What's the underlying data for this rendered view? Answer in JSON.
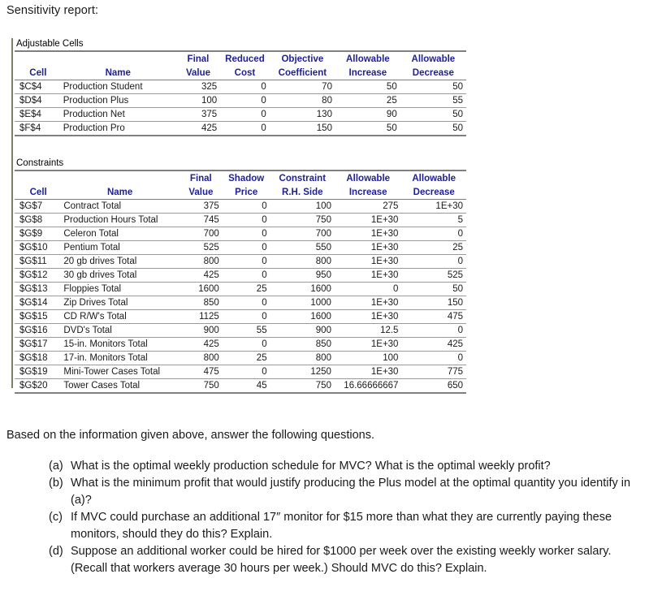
{
  "page": {
    "title": "Sensitivity report:"
  },
  "report": {
    "adjustable": {
      "label": "Adjustable Cells",
      "headers": [
        [
          "",
          "",
          "Final",
          "Reduced",
          "Objective",
          "Allowable",
          "Allowable"
        ],
        [
          "Cell",
          "Name",
          "Value",
          "Cost",
          "Coefficient",
          "Increase",
          "Decrease"
        ]
      ],
      "rows": [
        [
          "$C$4",
          "Production Student",
          "325",
          "0",
          "70",
          "50",
          "50"
        ],
        [
          "$D$4",
          "Production Plus",
          "100",
          "0",
          "80",
          "25",
          "55"
        ],
        [
          "$E$4",
          "Production Net",
          "375",
          "0",
          "130",
          "90",
          "50"
        ],
        [
          "$F$4",
          "Production Pro",
          "425",
          "0",
          "150",
          "50",
          "50"
        ]
      ]
    },
    "constraints": {
      "label": "Constraints",
      "headers": [
        [
          "",
          "",
          "Final",
          "Shadow",
          "Constraint",
          "Allowable",
          "Allowable"
        ],
        [
          "Cell",
          "Name",
          "Value",
          "Price",
          "R.H. Side",
          "Increase",
          "Decrease"
        ]
      ],
      "rows": [
        [
          "$G$7",
          "Contract Total",
          "375",
          "0",
          "100",
          "275",
          "1E+30"
        ],
        [
          "$G$8",
          "Production Hours Total",
          "745",
          "0",
          "750",
          "1E+30",
          "5"
        ],
        [
          "$G$9",
          "Celeron Total",
          "700",
          "0",
          "700",
          "1E+30",
          "0"
        ],
        [
          "$G$10",
          "Pentium Total",
          "525",
          "0",
          "550",
          "1E+30",
          "25"
        ],
        [
          "$G$11",
          "20 gb drives Total",
          "800",
          "0",
          "800",
          "1E+30",
          "0"
        ],
        [
          "$G$12",
          "30 gb drives Total",
          "425",
          "0",
          "950",
          "1E+30",
          "525"
        ],
        [
          "$G$13",
          "Floppies Total",
          "1600",
          "25",
          "1600",
          "0",
          "50"
        ],
        [
          "$G$14",
          "Zip Drives Total",
          "850",
          "0",
          "1000",
          "1E+30",
          "150"
        ],
        [
          "$G$15",
          "CD R/W's Total",
          "1125",
          "0",
          "1600",
          "1E+30",
          "475"
        ],
        [
          "$G$16",
          "DVD's Total",
          "900",
          "55",
          "900",
          "12.5",
          "0"
        ],
        [
          "$G$17",
          "15-in. Monitors Total",
          "425",
          "0",
          "850",
          "1E+30",
          "425"
        ],
        [
          "$G$18",
          "17-in. Monitors Total",
          "800",
          "25",
          "800",
          "100",
          "0"
        ],
        [
          "$G$19",
          "Mini-Tower Cases Total",
          "475",
          "0",
          "1250",
          "1E+30",
          "775"
        ],
        [
          "$G$20",
          "Tower Cases Total",
          "750",
          "45",
          "750",
          "16.66666667",
          "650"
        ]
      ]
    }
  },
  "questions": {
    "intro": "Based on the information given above, answer the following questions.",
    "items": [
      {
        "marker": "(a)",
        "text": "What is the optimal weekly production schedule for MVC? What is the optimal weekly profit?"
      },
      {
        "marker": "(b)",
        "text": "What is the minimum profit that would justify producing the Plus model at the optimal quantity you identify in (a)?"
      },
      {
        "marker": "(c)",
        "text": "If MVC could purchase an additional 17″ monitor for $15 more than what they are currently paying these monitors, should they do this? Explain."
      },
      {
        "marker": "(d)",
        "text": "Suppose an additional worker could be hired for $1000 per week over the existing weekly worker salary. (Recall that workers average 30 hours per week.) Should MVC do this? Explain."
      }
    ]
  },
  "colors": {
    "header_text": "#202099",
    "body_text": "#1a1a1a",
    "rule": "#7f7f7f",
    "outer_rule": "#808068"
  }
}
